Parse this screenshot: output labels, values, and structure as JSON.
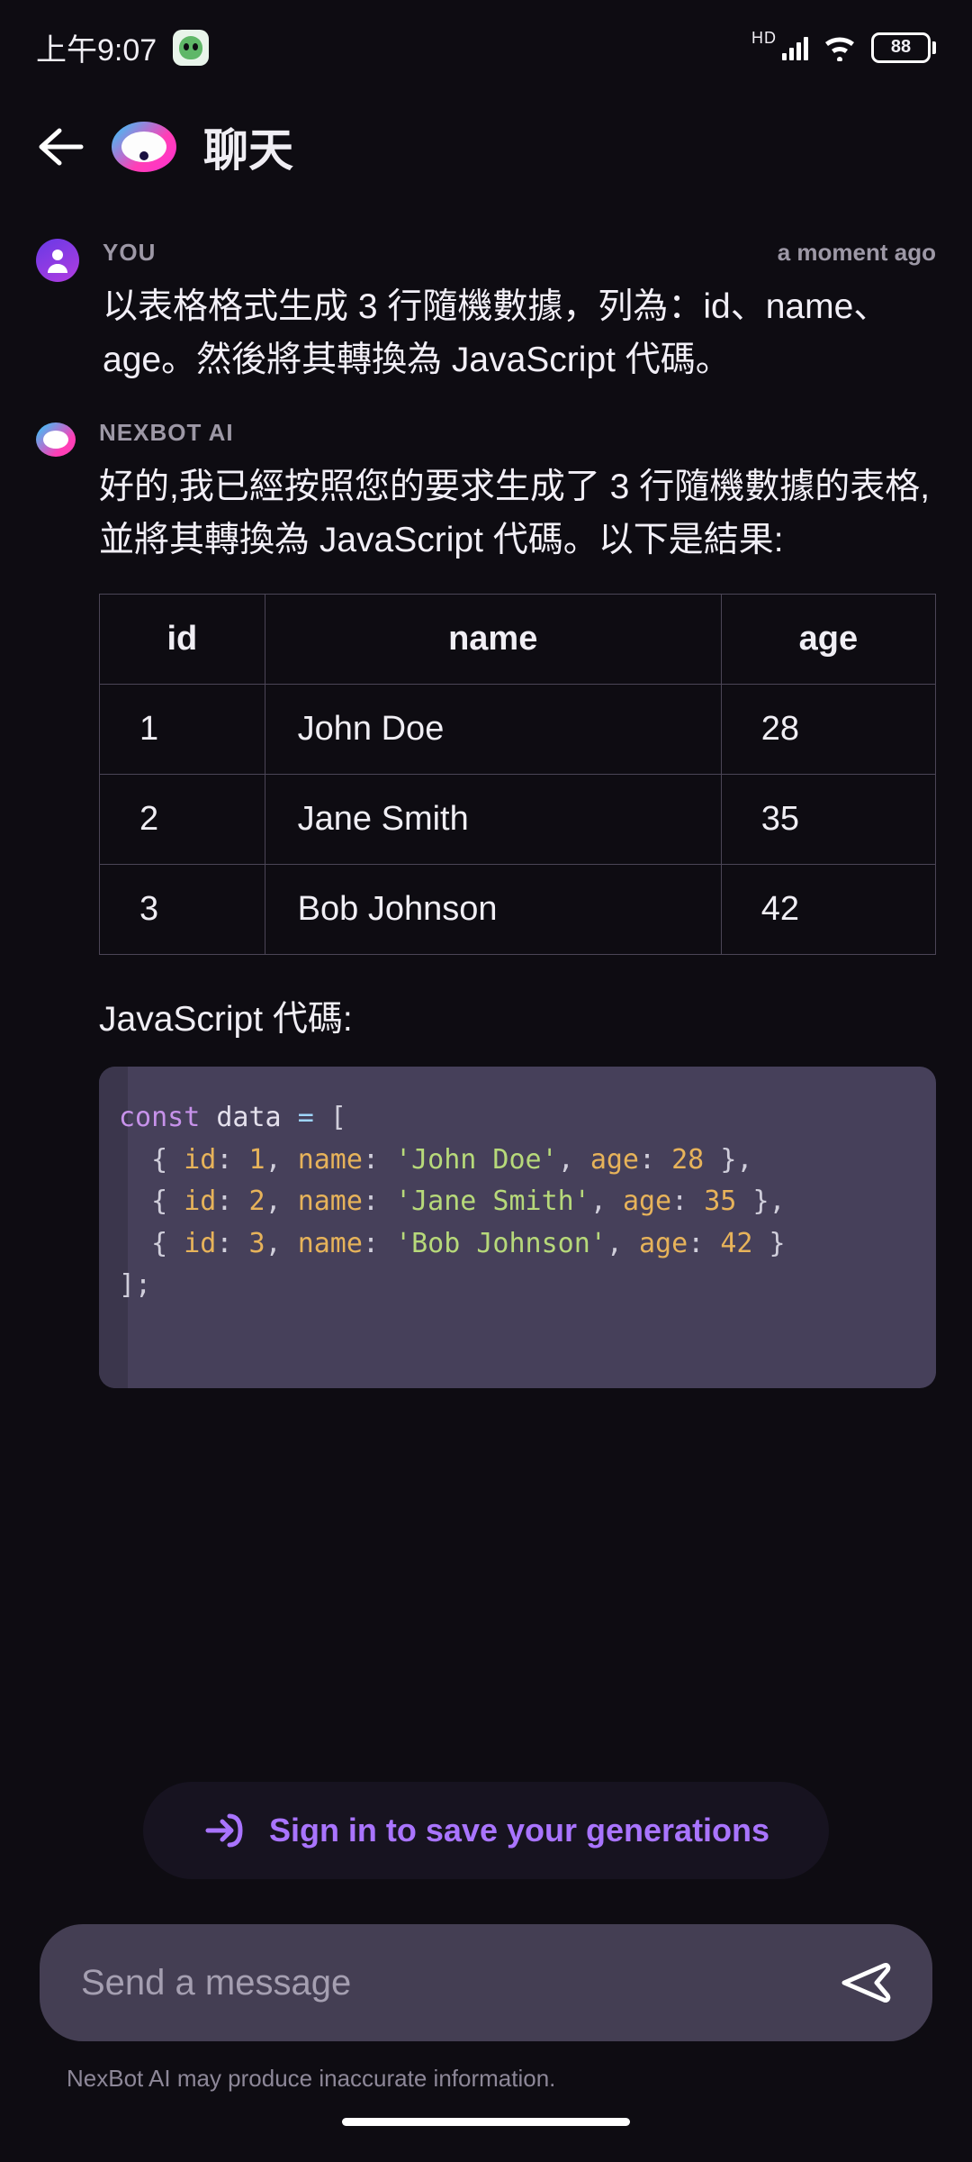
{
  "status": {
    "time": "上午9:07",
    "hd": "HD",
    "wifi_sub": "6",
    "battery": "88"
  },
  "header": {
    "title": "聊天"
  },
  "chat": {
    "user": {
      "sender": "YOU",
      "timestamp": "a moment ago",
      "text": "以表格格式生成 3 行隨機數據，列為：id、name、age。然後將其轉換為 JavaScript 代碼。"
    },
    "bot": {
      "sender": "NEXBOT AI",
      "intro": "好的,我已經按照您的要求生成了 3 行隨機數據的表格,並將其轉換為 JavaScript 代碼。以下是結果:",
      "table": {
        "headers": [
          "id",
          "name",
          "age"
        ],
        "rows": [
          {
            "id": "1",
            "name": "John Doe",
            "age": "28"
          },
          {
            "id": "2",
            "name": "Jane Smith",
            "age": "35"
          },
          {
            "id": "3",
            "name": "Bob Johnson",
            "age": "42"
          }
        ]
      },
      "code_label": "JavaScript 代碼:",
      "code": {
        "kw_const": "const",
        "var": "data",
        "rows": [
          {
            "id": "1",
            "name": "'John Doe'",
            "age": "28"
          },
          {
            "id": "2",
            "name": "'Jane Smith'",
            "age": "35"
          },
          {
            "id": "3",
            "name": "'Bob Johnson'",
            "age": "42"
          }
        ]
      }
    }
  },
  "signin": {
    "label": "Sign in to save your generations"
  },
  "composer": {
    "placeholder": "Send a message"
  },
  "disclaimer": "NexBot AI may produce inaccurate information."
}
